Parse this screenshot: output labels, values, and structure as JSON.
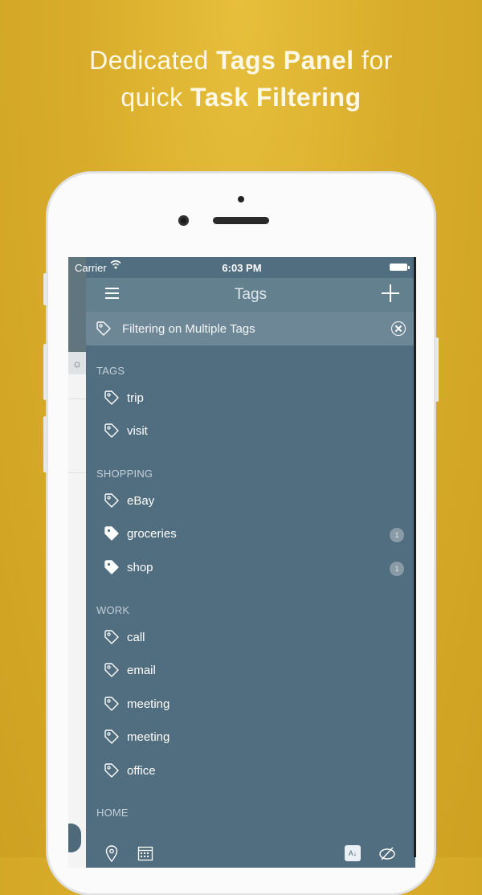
{
  "headline": {
    "line1_pre": "Dedicated ",
    "line1_bold": "Tags Panel",
    "line1_post": " for",
    "line2_pre": "quick ",
    "line2_bold": "Task Filtering"
  },
  "status_bar": {
    "carrier": "Carrier",
    "time": "6:03 PM"
  },
  "navbar": {
    "title": "Tags"
  },
  "filter_bar": {
    "text": "Filtering on Multiple Tags"
  },
  "sections": [
    {
      "title": "TAGS",
      "items": [
        {
          "label": "trip",
          "selected": false,
          "count": ""
        },
        {
          "label": "visit",
          "selected": false,
          "count": ""
        }
      ]
    },
    {
      "title": "SHOPPING",
      "items": [
        {
          "label": "eBay",
          "selected": false,
          "count": ""
        },
        {
          "label": "groceries",
          "selected": true,
          "count": "1"
        },
        {
          "label": "shop",
          "selected": true,
          "count": "1"
        }
      ]
    },
    {
      "title": "WORK",
      "items": [
        {
          "label": "call",
          "selected": false,
          "count": ""
        },
        {
          "label": "email",
          "selected": false,
          "count": ""
        },
        {
          "label": "meeting",
          "selected": false,
          "count": ""
        },
        {
          "label": "meeting",
          "selected": false,
          "count": ""
        },
        {
          "label": "office",
          "selected": false,
          "count": ""
        }
      ]
    },
    {
      "title": "HOME",
      "items": []
    }
  ],
  "toolbar": {
    "icons": [
      "location-pin-icon",
      "calendar-icon",
      "sort-az-icon",
      "hide-icon"
    ],
    "sort_label": "A↓"
  },
  "colors": {
    "background": "#d9ad2b",
    "panel": "#516e80",
    "navbar": "#63808f",
    "filter_bar": "#6e8797"
  }
}
